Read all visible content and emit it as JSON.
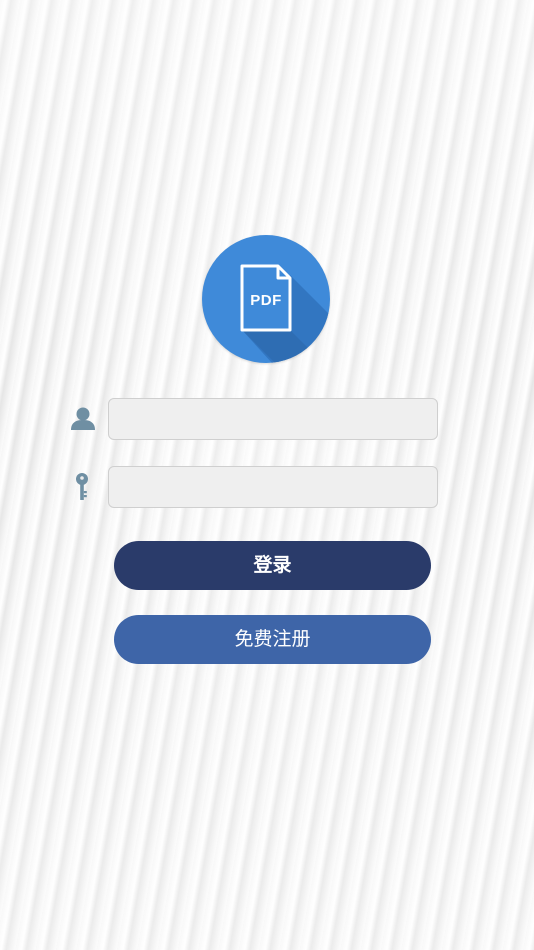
{
  "logo": {
    "label": "PDF",
    "icon": "pdf-document-icon",
    "circle_color": "#3f8ad9"
  },
  "form": {
    "username": {
      "icon": "user-icon",
      "value": "",
      "placeholder": ""
    },
    "password": {
      "icon": "key-icon",
      "value": "",
      "placeholder": ""
    }
  },
  "buttons": {
    "login_label": "登录",
    "login_color": "#2a3b6a",
    "register_label": "免费注册",
    "register_color": "#3e65a8"
  }
}
